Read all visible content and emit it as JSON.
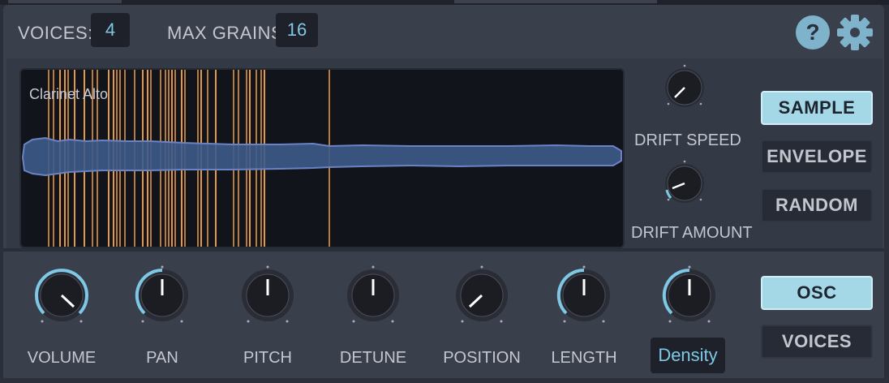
{
  "header": {
    "voices_label": "VOICES:",
    "voices_value": "4",
    "max_grains_label": "MAX GRAINS:",
    "max_grains_value": "16",
    "help_icon": "question-icon",
    "settings_icon": "gear-icon"
  },
  "waveform": {
    "sample_name": "Clarinet Alto"
  },
  "drift": {
    "speed_label": "DRIFT SPEED",
    "amount_label": "DRIFT AMOUNT"
  },
  "source_modes": {
    "items": [
      "SAMPLE",
      "ENVELOPE",
      "RANDOM"
    ],
    "active": "SAMPLE"
  },
  "knobs": {
    "volume": "VOLUME",
    "pan": "PAN",
    "pitch": "PITCH",
    "detune": "DETUNE",
    "position": "POSITION",
    "length": "LENGTH",
    "density": "Density"
  },
  "page_modes": {
    "items": [
      "OSC",
      "VOICES"
    ],
    "active": "OSC"
  },
  "colors": {
    "accent": "#7ec8e6",
    "grain": "#f0a04b",
    "waveform": "#3d5a8a",
    "active_button": "#a4d8e6"
  }
}
